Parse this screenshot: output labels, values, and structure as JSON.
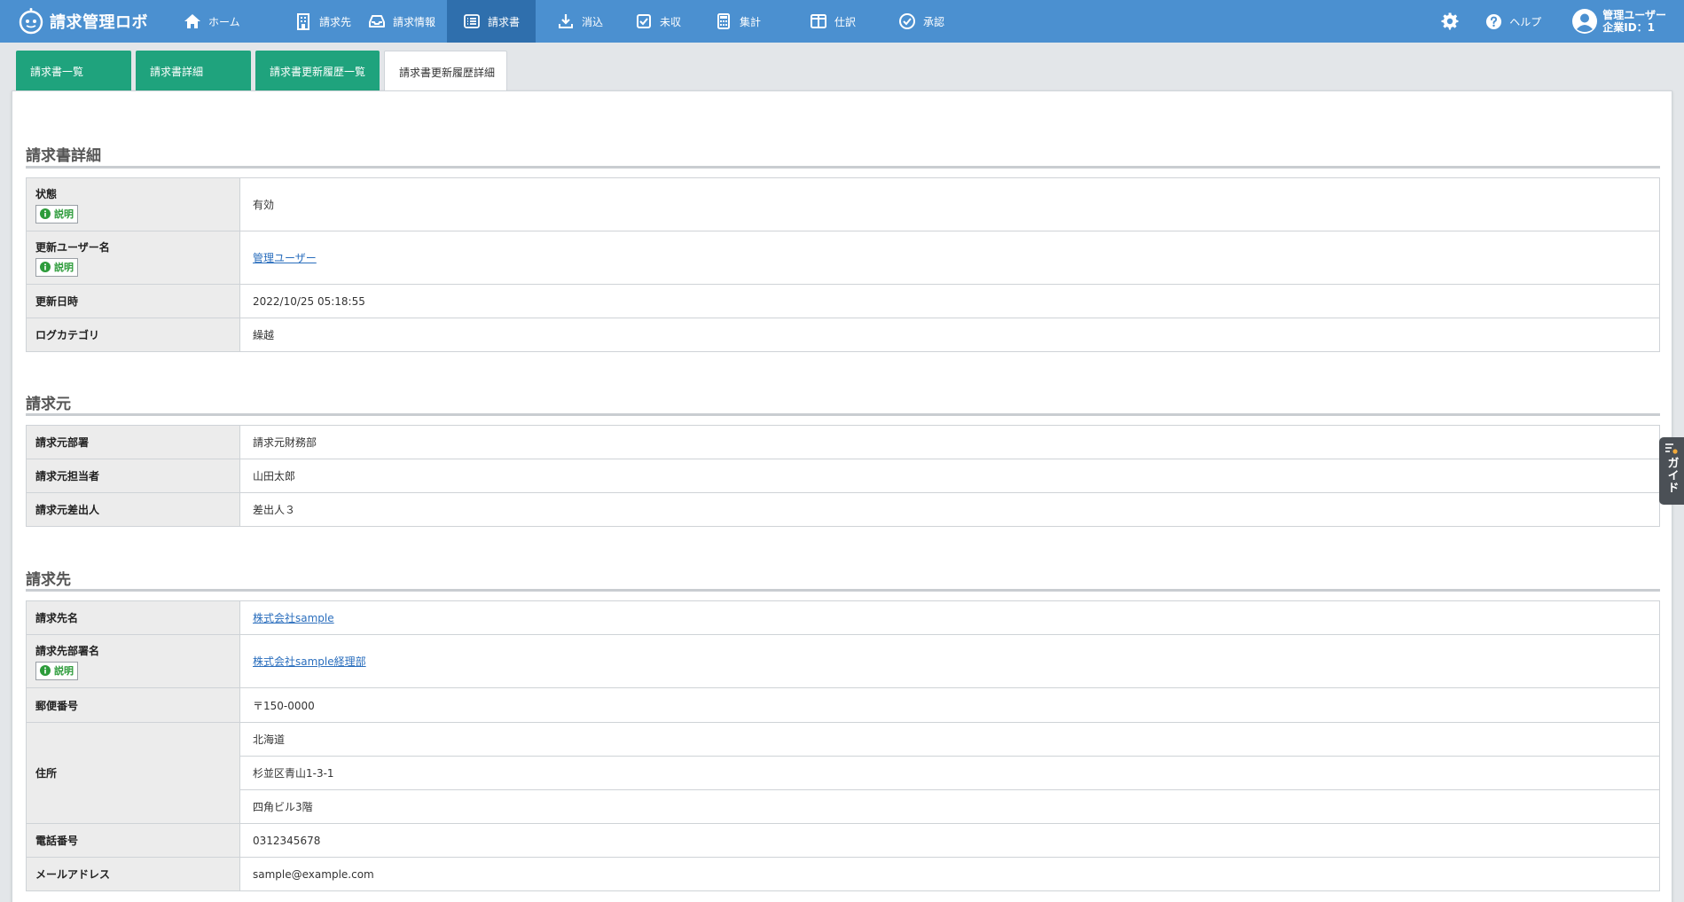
{
  "app": {
    "title": "請求管理ロボ"
  },
  "nav": {
    "items": [
      {
        "label": "ホーム",
        "icon": "home-icon"
      },
      {
        "label": "請求先",
        "icon": "building-icon"
      },
      {
        "label": "請求情報",
        "icon": "tray-icon"
      },
      {
        "label": "請求書",
        "icon": "list-icon"
      },
      {
        "label": "消込",
        "icon": "download-icon"
      },
      {
        "label": "未収",
        "icon": "checkbox-icon"
      },
      {
        "label": "集計",
        "icon": "calculator-icon"
      },
      {
        "label": "仕訳",
        "icon": "columns-icon"
      },
      {
        "label": "承認",
        "icon": "check-circle-icon"
      }
    ],
    "active": "請求書",
    "help": "ヘルプ",
    "user_name": "管理ユーザー",
    "company_id": "企業ID：1"
  },
  "tabs": [
    {
      "label": "請求書一覧"
    },
    {
      "label": "請求書詳細"
    },
    {
      "label": "請求書更新履歴一覧"
    },
    {
      "label": "請求書更新履歴詳細"
    }
  ],
  "explain_label": "説明",
  "sections": {
    "detail": {
      "title": "請求書詳細",
      "status": {
        "label": "状態",
        "value": "有効"
      },
      "update_user": {
        "label": "更新ユーザー名",
        "value": "管理ユーザー"
      },
      "updated_at": {
        "label": "更新日時",
        "value": "2022/10/25 05:18:55"
      },
      "log_category": {
        "label": "ログカテゴリ",
        "value": "繰越"
      }
    },
    "billing_source": {
      "title": "請求元",
      "department": {
        "label": "請求元部署",
        "value": "請求元財務部"
      },
      "person": {
        "label": "請求元担当者",
        "value": "山田太郎"
      },
      "sender": {
        "label": "請求元差出人",
        "value": "差出人３"
      }
    },
    "billing_dest": {
      "title": "請求先",
      "name": {
        "label": "請求先名",
        "value": "株式会社sample"
      },
      "department": {
        "label": "請求先部署名",
        "value": "株式会社sample経理部"
      },
      "postal": {
        "label": "郵便番号",
        "value": "〒150-0000"
      },
      "address": {
        "label": "住所",
        "lines": [
          "北海道",
          "杉並区青山1-3-1",
          "四角ビル3階"
        ]
      },
      "phone": {
        "label": "電話番号",
        "value": "0312345678"
      },
      "email": {
        "label": "メールアドレス",
        "value": "sample@example.com"
      }
    }
  },
  "guide": {
    "label": "ガイド"
  }
}
